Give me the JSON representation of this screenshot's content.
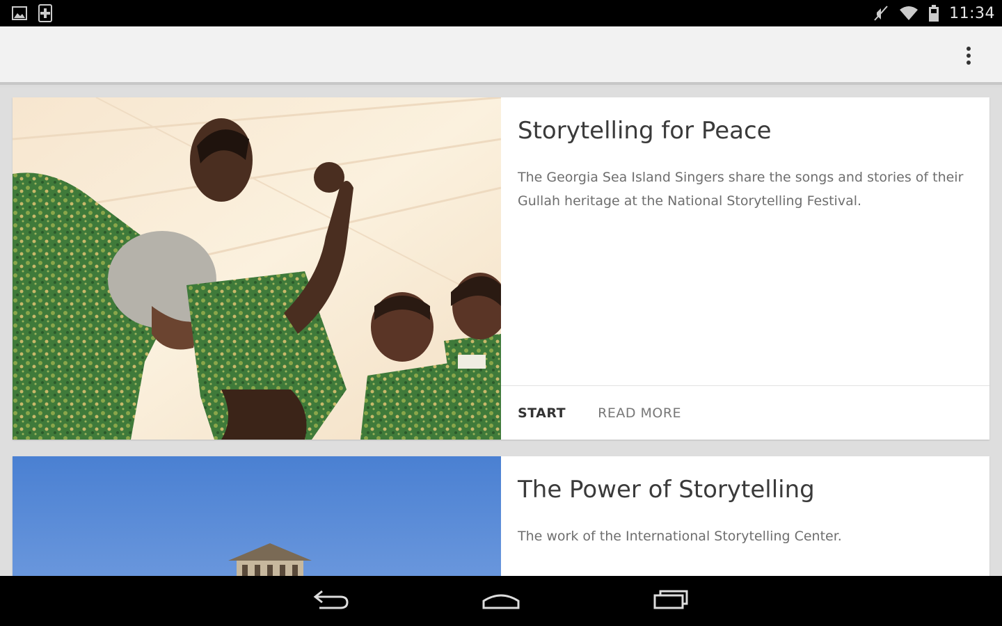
{
  "status_bar": {
    "time": "11:34",
    "left_icons": [
      "gallery-icon",
      "sim-icon"
    ],
    "right_icons": [
      "mute-icon",
      "wifi-icon",
      "battery-icon"
    ]
  },
  "action_bar": {
    "overflow_icon": "overflow-menu-icon"
  },
  "cards": [
    {
      "title": "Storytelling for Peace",
      "description": "The Georgia Sea Island Singers share the songs and stories of their Gullah heritage at the National Storytelling Festival.",
      "actions": {
        "start": "START",
        "read_more": "READ MORE"
      },
      "image_desc": "singers-photo"
    },
    {
      "title": "The Power of Storytelling",
      "description": "The work of the International Storytelling Center.",
      "image_desc": "building-sky-photo"
    }
  ],
  "nav_bar": {
    "icons": [
      "back-icon",
      "home-icon",
      "recents-icon"
    ]
  },
  "colors": {
    "status_bar": "#000000",
    "action_bar": "#f2f2f2",
    "background": "#dedede",
    "card": "#ffffff",
    "sky": "#4a7fd0",
    "shirt_green": "#3f7a3a"
  }
}
